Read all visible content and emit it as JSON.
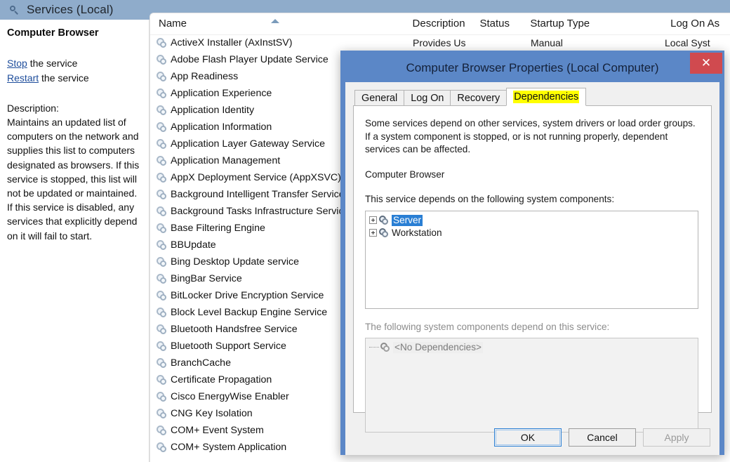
{
  "console": {
    "title": "Services (Local)",
    "icon": "magnifier-icon"
  },
  "detail_pane": {
    "service_name": "Computer Browser",
    "actions": [
      {
        "link": "Stop",
        "rest": " the service"
      },
      {
        "link": "Restart",
        "rest": " the service"
      }
    ],
    "description_label": "Description:",
    "description": "Maintains an updated list of computers on the network and supplies this list to computers designated as browsers. If this service is stopped, this list will not be updated or maintained. If this service is disabled, any services that explicitly depend on it will fail to start."
  },
  "list": {
    "columns": {
      "name": "Name",
      "description": "Description",
      "status": "Status",
      "startup_type": "Startup Type",
      "log_on_as": "Log On As"
    },
    "sort_indicator": "ascending",
    "partial_row": {
      "description": "Provides Us",
      "startup_type": "Manual",
      "log_on_as": "Local Syst"
    },
    "services": [
      "ActiveX Installer (AxInstSV)",
      "Adobe Flash Player Update Service",
      "App Readiness",
      "Application Experience",
      "Application Identity",
      "Application Information",
      "Application Layer Gateway Service",
      "Application Management",
      "AppX Deployment Service (AppXSVC)",
      "Background Intelligent Transfer Service",
      "Background Tasks Infrastructure Service",
      "Base Filtering Engine",
      "BBUpdate",
      "Bing Desktop Update service",
      "BingBar Service",
      "BitLocker Drive Encryption Service",
      "Block Level Backup Engine Service",
      "Bluetooth Handsfree Service",
      "Bluetooth Support Service",
      "BranchCache",
      "Certificate Propagation",
      "Cisco EnergyWise Enabler",
      "CNG Key Isolation",
      "COM+ Event System",
      "COM+ System Application"
    ]
  },
  "dialog": {
    "title": "Computer Browser Properties (Local Computer)",
    "close_label": "✕",
    "tabs": [
      {
        "label": "General",
        "active": false
      },
      {
        "label": "Log On",
        "active": false
      },
      {
        "label": "Recovery",
        "active": false
      },
      {
        "label": "Dependencies",
        "active": true
      }
    ],
    "intro": "Some services depend on other services, system drivers or load order groups. If a system component is stopped, or is not running properly, dependent services can be affected.",
    "service_name": "Computer Browser",
    "depends_on_label": "This service depends on the following system components:",
    "depends_on_items": [
      {
        "label": "Server",
        "selected": true
      },
      {
        "label": "Workstation",
        "selected": false
      }
    ],
    "dependents_label": "The following system components depend on this service:",
    "dependents_items": [
      {
        "label": "<No Dependencies>"
      }
    ],
    "buttons": {
      "ok": "OK",
      "cancel": "Cancel",
      "apply": "Apply"
    }
  },
  "colors": {
    "header_bar": "#8faccb",
    "dialog_frame": "#5b87c7",
    "close_button": "#d04a4f",
    "highlight_yellow": "#ffff00",
    "selection_blue": "#2a7fd4",
    "link_blue": "#1f4e9c"
  }
}
